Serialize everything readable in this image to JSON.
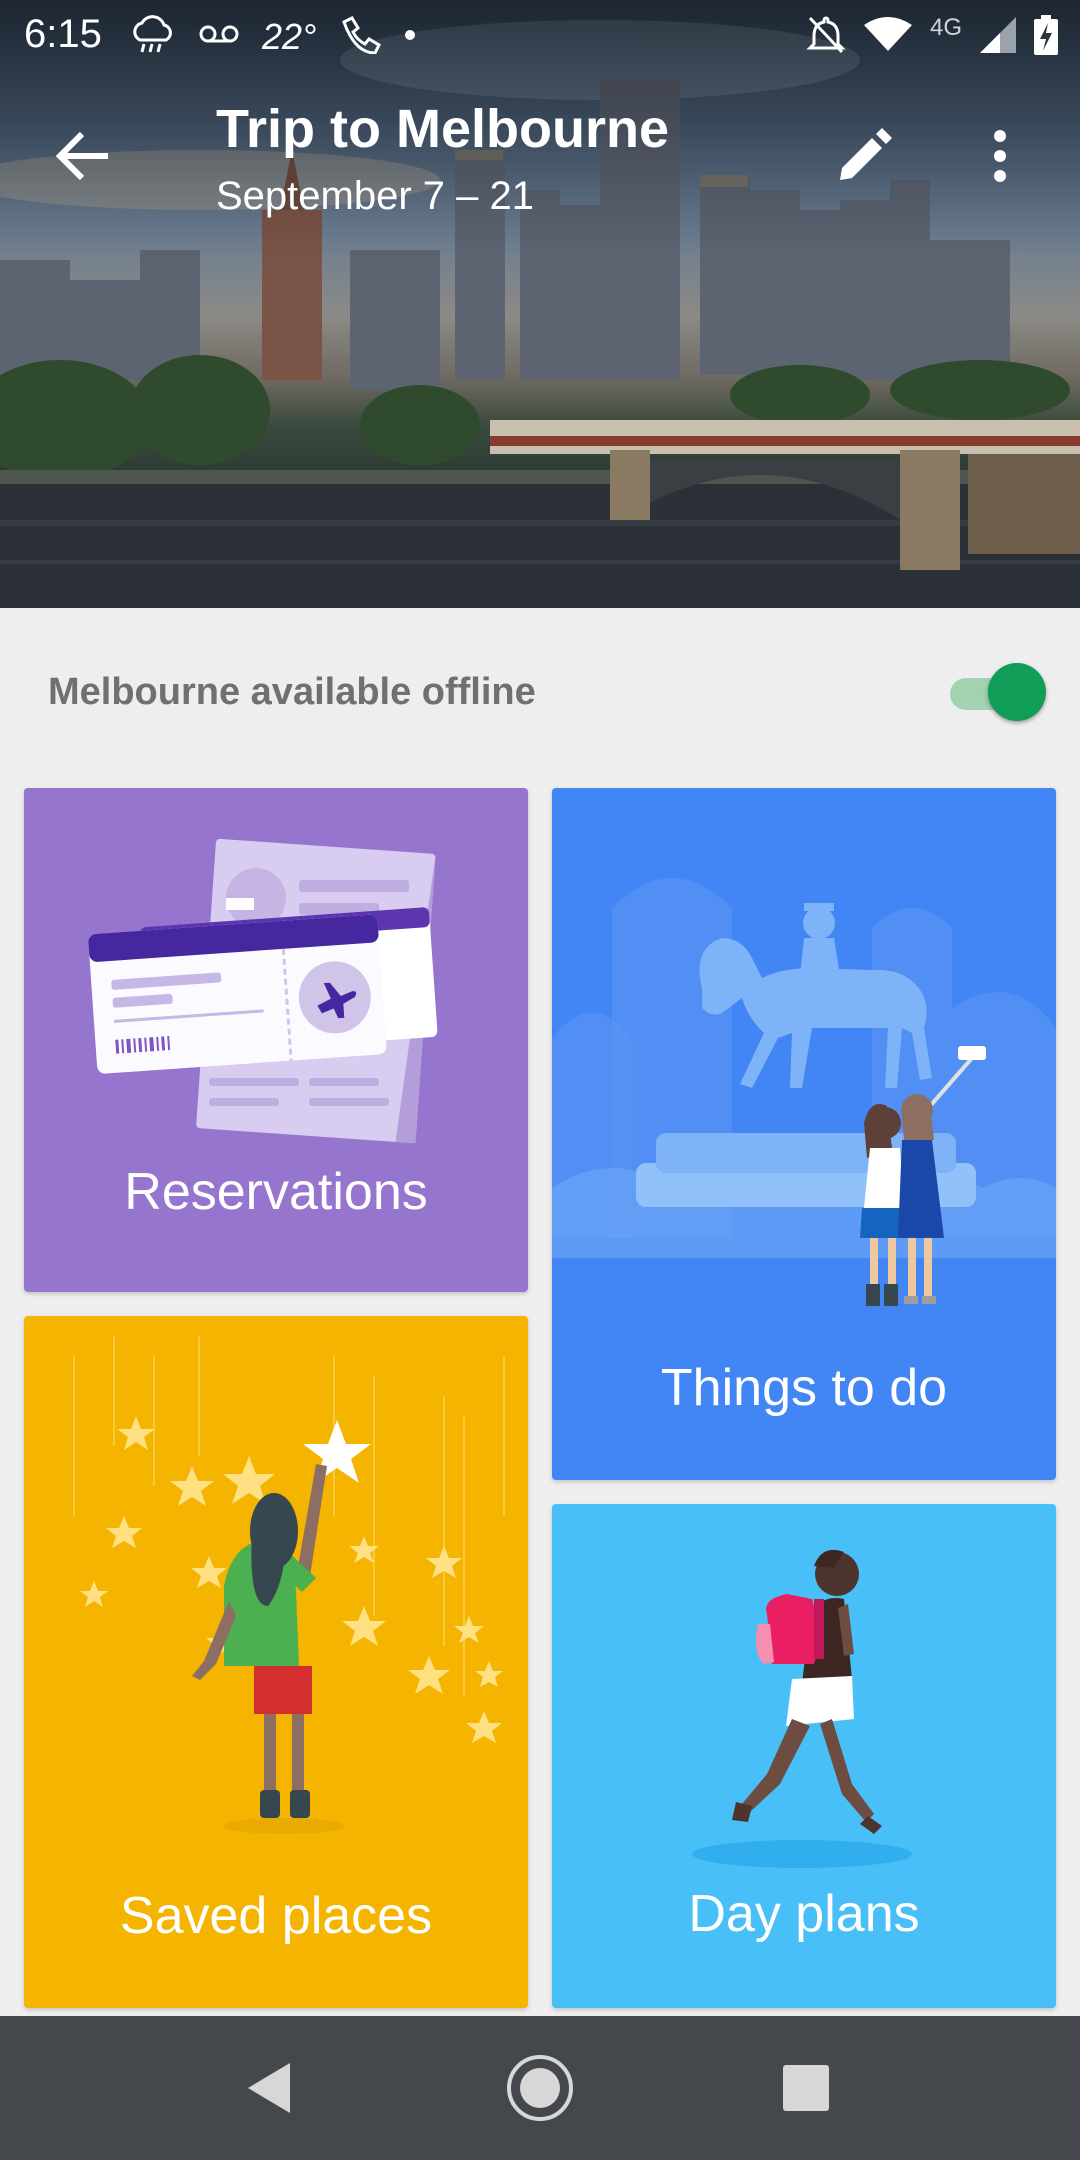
{
  "status_bar": {
    "time": "6:15",
    "temperature": "22°",
    "network": "4G",
    "icons": [
      "rain-cloud-icon",
      "voicemail-icon",
      "wifi-call-icon",
      "notification-dot-icon",
      "notifications-off-icon",
      "wifi-icon",
      "cell-signal-icon",
      "battery-charging-icon"
    ]
  },
  "trip": {
    "title": "Trip to Melbourne",
    "dates": "September 7 – 21"
  },
  "offline": {
    "label": "Melbourne available offline",
    "enabled": true
  },
  "cards": {
    "reservations": "Reservations",
    "things_to_do": "Things to do",
    "saved_places": "Saved places",
    "day_plans": "Day plans"
  },
  "colors": {
    "reservations": "#9575cd",
    "things_to_do": "#4285f4",
    "saved_places": "#f4b400",
    "day_plans": "#48c0f7",
    "toggle_on": "#0f9d58",
    "nav_bar": "#44484d"
  }
}
